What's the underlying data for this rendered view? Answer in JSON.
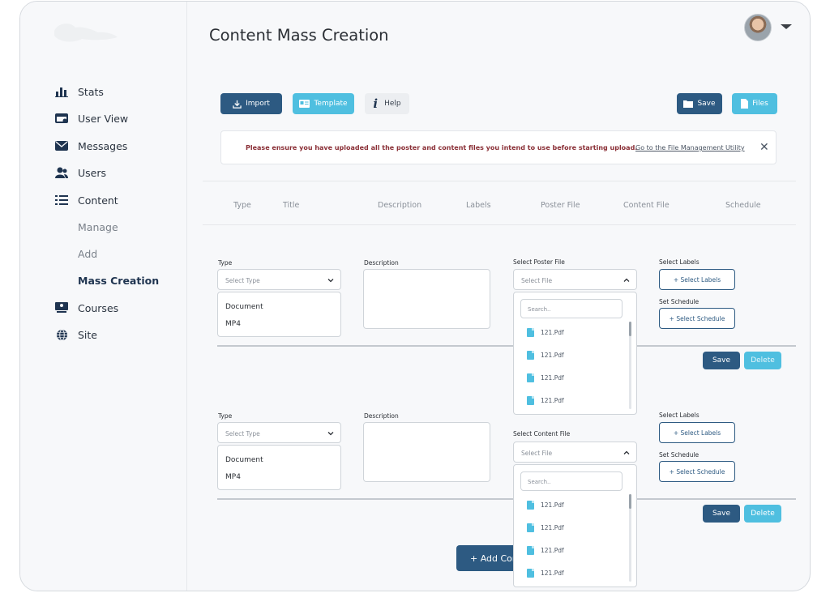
{
  "sidebar": {
    "items": [
      {
        "label": "Stats",
        "icon": "bar-chart-icon"
      },
      {
        "label": "User View",
        "icon": "browser-icon"
      },
      {
        "label": "Messages",
        "icon": "envelope-icon"
      },
      {
        "label": "Users",
        "icon": "users-icon"
      },
      {
        "label": "Content",
        "icon": "list-icon"
      },
      {
        "label": "Manage"
      },
      {
        "label": "Add"
      },
      {
        "label": "Mass Creation"
      },
      {
        "label": "Courses",
        "icon": "presentation-icon"
      },
      {
        "label": "Site",
        "icon": "globe-icon"
      }
    ]
  },
  "page": {
    "title": "Content Mass Creation"
  },
  "toolbar": {
    "import": "Import",
    "template": "Template",
    "help": "Help",
    "save": "Save",
    "files": "Files"
  },
  "notice": {
    "text": "Please ensure you have uploaded all the poster and content files you intend to use before starting upload.",
    "link": "Go to the File Management Utility"
  },
  "columns": [
    "Type",
    "Title",
    "Description",
    "Labels",
    "Poster File",
    "Content File",
    "Schedule"
  ],
  "row1": {
    "type_label": "Type",
    "type_placeholder": "Select Type",
    "type_options": [
      "Document",
      "MP4"
    ],
    "description_label": "Description",
    "file_label": "Select Poster File",
    "file_placeholder": "Select File",
    "search_placeholder": "Search..",
    "files": [
      "121.Pdf",
      "121.Pdf",
      "121.Pdf",
      "121.Pdf"
    ],
    "labels_label": "Select Labels",
    "labels_button": "+ Select Labels",
    "schedule_label": "Set Schedule",
    "schedule_button": "+ Select Schedule",
    "save": "Save",
    "delete": "Delete"
  },
  "row2": {
    "type_label": "Type",
    "type_placeholder": "Select Type",
    "type_options": [
      "Document",
      "MP4"
    ],
    "description_label": "Description",
    "file_label": "Select Content File",
    "file_placeholder": "Select File",
    "search_placeholder": "Search..",
    "files": [
      "121.Pdf",
      "121.Pdf",
      "121.Pdf",
      "121.Pdf"
    ],
    "labels_label": "Select Labels",
    "labels_button": "+ Select Labels",
    "schedule_label": "Set Schedule",
    "schedule_button": "+ Select Schedule",
    "save": "Save",
    "delete": "Delete"
  },
  "add_button": "+ Add Con",
  "colors": {
    "primary": "#2d5a82",
    "accent": "#4fbfe0",
    "warning": "#8a2f36"
  }
}
